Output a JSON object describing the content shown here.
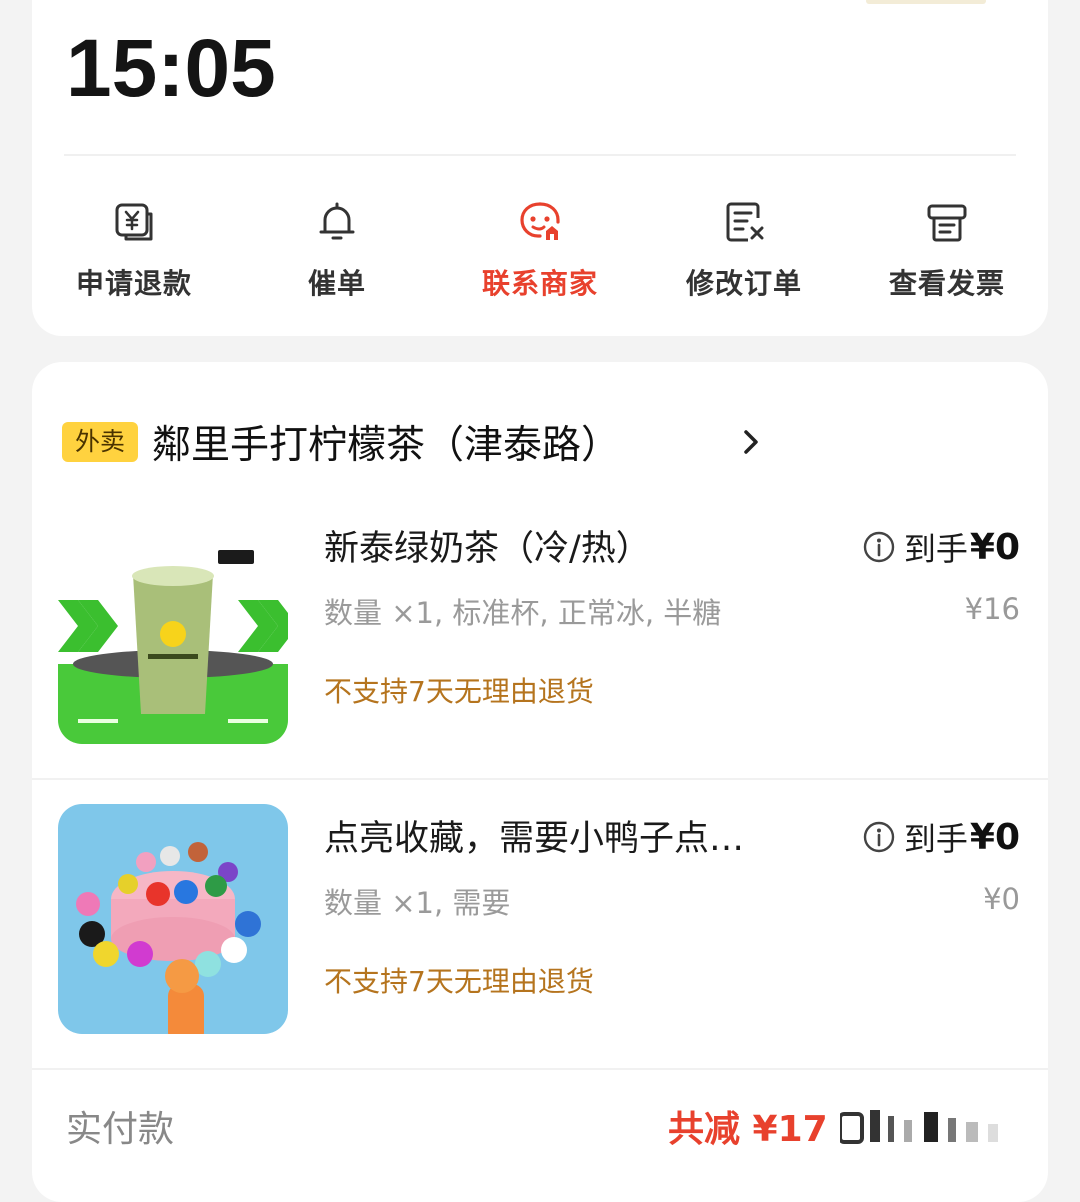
{
  "status": {
    "time": "15:05"
  },
  "actions": [
    {
      "label": "申请退款",
      "icon": "refund-icon",
      "active": false
    },
    {
      "label": "催单",
      "icon": "bell-icon",
      "active": false
    },
    {
      "label": "联系商家",
      "icon": "merchant-chat-icon",
      "active": true
    },
    {
      "label": "修改订单",
      "icon": "edit-order-icon",
      "active": false
    },
    {
      "label": "查看发票",
      "icon": "invoice-icon",
      "active": false
    }
  ],
  "order": {
    "tag": "外卖",
    "shop_name": "鄰里手打柠檬茶（津泰路）",
    "items": [
      {
        "name": "新泰绿奶茶（冷/热）",
        "spec": "数量 ×1, 标准杯, 正常冰, 半糖",
        "policy": "不支持7天无理由退货",
        "price_label": "到手",
        "price": "¥0",
        "original": "¥16",
        "image": "green-milk-tea-image"
      },
      {
        "name": "点亮收藏，需要小鸭子点…",
        "spec": "数量 ×1, 需要",
        "policy": "不支持7天无理由退货",
        "price_label": "到手",
        "price": "¥0",
        "original": "¥0",
        "image": "rubber-ducks-image"
      }
    ],
    "paid_label": "实付款",
    "discount": "共减 ¥17"
  },
  "colors": {
    "accent_red": "#e8412d",
    "tag_yellow": "#ffd23f",
    "policy_orange": "#b5741e",
    "page_bg": "#f3f3f3"
  }
}
